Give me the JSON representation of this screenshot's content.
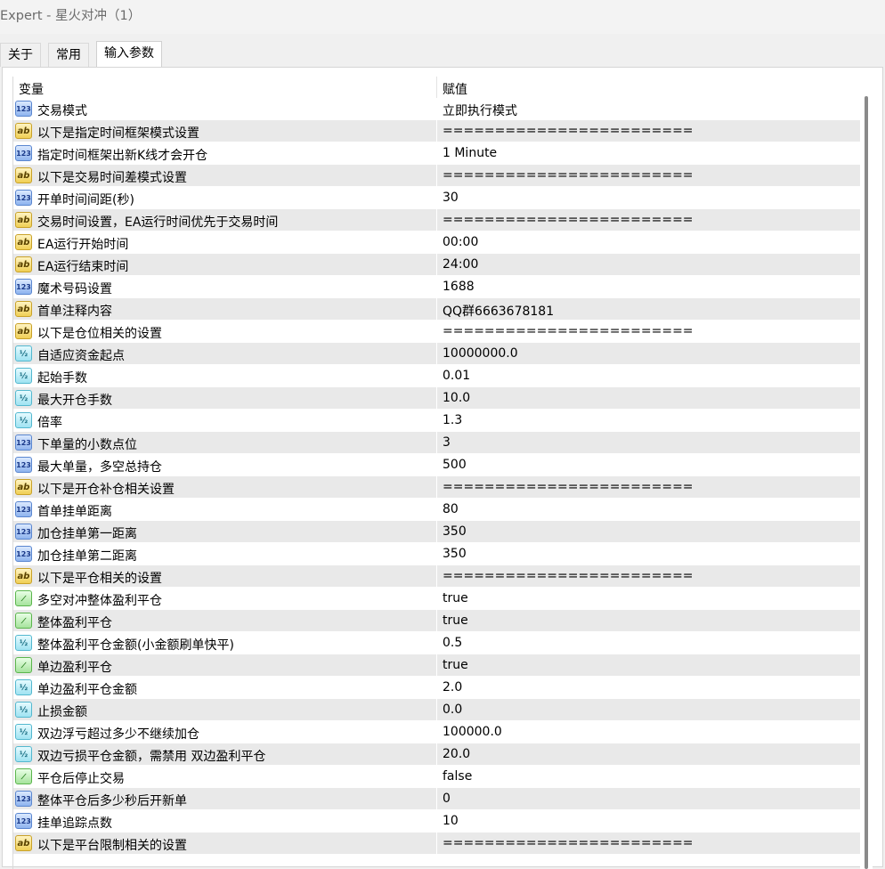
{
  "window": {
    "title": "Expert - 星火对冲（1）"
  },
  "tabs": [
    {
      "label": "关于"
    },
    {
      "label": "常用"
    },
    {
      "label": "输入参数"
    }
  ],
  "table": {
    "headers": {
      "variable": "变量",
      "value": "赋值"
    },
    "rows": [
      {
        "icon": "int",
        "name": "交易模式",
        "value": "立即执行模式"
      },
      {
        "icon": "str",
        "name": "以下是指定时间框架模式设置",
        "value": "========================"
      },
      {
        "icon": "int",
        "name": "指定时间框架出新K线才会开仓",
        "value": "1 Minute"
      },
      {
        "icon": "str",
        "name": "以下是交易时间差模式设置",
        "value": "========================"
      },
      {
        "icon": "int",
        "name": "开单时间间距(秒)",
        "value": "30"
      },
      {
        "icon": "str",
        "name": "交易时间设置，EA运行时间优先于交易时间",
        "value": "========================"
      },
      {
        "icon": "str",
        "name": "EA运行开始时间",
        "value": "00:00"
      },
      {
        "icon": "str",
        "name": "EA运行结束时间",
        "value": "24:00"
      },
      {
        "icon": "int",
        "name": "魔术号码设置",
        "value": "1688"
      },
      {
        "icon": "str",
        "name": "首单注释内容",
        "value": "QQ群6663678181"
      },
      {
        "icon": "str",
        "name": "以下是仓位相关的设置",
        "value": "========================"
      },
      {
        "icon": "dbl",
        "name": "自适应资金起点",
        "value": "10000000.0"
      },
      {
        "icon": "dbl",
        "name": "起始手数",
        "value": "0.01"
      },
      {
        "icon": "dbl",
        "name": "最大开仓手数",
        "value": "10.0"
      },
      {
        "icon": "dbl",
        "name": "倍率",
        "value": "1.3"
      },
      {
        "icon": "int",
        "name": "下单量的小数点位",
        "value": "3"
      },
      {
        "icon": "int",
        "name": "最大单量，多空总持仓",
        "value": "500"
      },
      {
        "icon": "str",
        "name": "以下是开仓补仓相关设置",
        "value": "========================"
      },
      {
        "icon": "int",
        "name": "首单挂单距离",
        "value": "80"
      },
      {
        "icon": "int",
        "name": "加仓挂单第一距离",
        "value": "350"
      },
      {
        "icon": "int",
        "name": "加仓挂单第二距离",
        "value": "350"
      },
      {
        "icon": "str",
        "name": "以下是平仓相关的设置",
        "value": "========================"
      },
      {
        "icon": "bool",
        "name": "多空对冲整体盈利平仓",
        "value": "true"
      },
      {
        "icon": "bool",
        "name": "整体盈利平仓",
        "value": "true"
      },
      {
        "icon": "dbl",
        "name": "整体盈利平仓金额(小金额刷单快平)",
        "value": "0.5"
      },
      {
        "icon": "bool",
        "name": "单边盈利平仓",
        "value": "true"
      },
      {
        "icon": "dbl",
        "name": "单边盈利平仓金额",
        "value": "2.0"
      },
      {
        "icon": "dbl",
        "name": "止损金额",
        "value": "0.0"
      },
      {
        "icon": "dbl",
        "name": "双边浮亏超过多少不继续加仓",
        "value": "100000.0"
      },
      {
        "icon": "dbl",
        "name": "双边亏损平仓金额，需禁用 双边盈利平仓",
        "value": "20.0"
      },
      {
        "icon": "bool",
        "name": "平仓后停止交易",
        "value": "false"
      },
      {
        "icon": "int",
        "name": "整体平仓后多少秒后开新单",
        "value": "0"
      },
      {
        "icon": "int",
        "name": "挂单追踪点数",
        "value": "10"
      },
      {
        "icon": "str",
        "name": "以下是平台限制相关的设置",
        "value": "========================"
      }
    ]
  }
}
